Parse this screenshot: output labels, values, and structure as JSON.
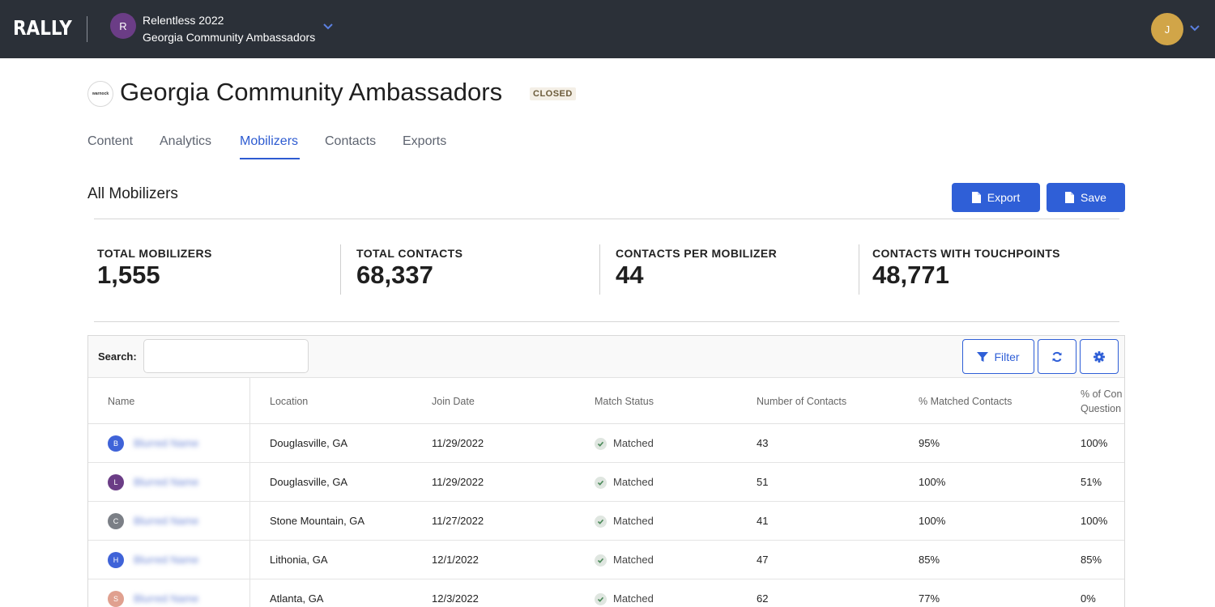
{
  "app": {
    "logo": "RALLY",
    "org_initial": "R",
    "org_campaign": "Relentless 2022",
    "org_name": "Georgia Community Ambassadors",
    "user_initial": "J"
  },
  "header": {
    "brand_logo_text": "warnock",
    "title": "Georgia Community Ambassadors",
    "status": "CLOSED"
  },
  "tabs": [
    {
      "label": "Content"
    },
    {
      "label": "Analytics"
    },
    {
      "label": "Mobilizers",
      "active": true
    },
    {
      "label": "Contacts"
    },
    {
      "label": "Exports"
    }
  ],
  "section": {
    "title": "All Mobilizers",
    "export_label": "Export",
    "save_label": "Save"
  },
  "stats": [
    {
      "label": "TOTAL MOBILIZERS",
      "value": "1,555"
    },
    {
      "label": "TOTAL CONTACTS",
      "value": "68,337"
    },
    {
      "label": "CONTACTS PER MOBILIZER",
      "value": "44"
    },
    {
      "label": "CONTACTS WITH TOUCHPOINTS",
      "value": "48,771"
    }
  ],
  "table": {
    "search_label": "Search:",
    "search_value": "",
    "filter_label": "Filter",
    "columns": [
      "Name",
      "Location",
      "Join Date",
      "Match Status",
      "Number of Contacts",
      "% Matched Contacts",
      "% of Con",
      "Question"
    ],
    "rows": [
      {
        "initial": "B",
        "avatar_color": "#3f63d8",
        "name": "Blurred Name",
        "location": "Douglasville, GA",
        "join_date": "11/29/2022",
        "match_status": "Matched",
        "contacts": "43",
        "pct_matched": "95%",
        "pct_question": "100%"
      },
      {
        "initial": "L",
        "avatar_color": "#6b3d86",
        "name": "Blurred Name",
        "location": "Douglasville, GA",
        "join_date": "11/29/2022",
        "match_status": "Matched",
        "contacts": "51",
        "pct_matched": "100%",
        "pct_question": "51%"
      },
      {
        "initial": "C",
        "avatar_color": "#7b7f86",
        "name": "Blurred Name",
        "location": "Stone Mountain, GA",
        "join_date": "11/27/2022",
        "match_status": "Matched",
        "contacts": "41",
        "pct_matched": "100%",
        "pct_question": "100%"
      },
      {
        "initial": "H",
        "avatar_color": "#3f63d8",
        "name": "Blurred Name",
        "location": "Lithonia, GA",
        "join_date": "12/1/2022",
        "match_status": "Matched",
        "contacts": "47",
        "pct_matched": "85%",
        "pct_question": "85%"
      },
      {
        "initial": "S",
        "avatar_color": "#e0a08f",
        "name": "Blurred Name",
        "location": "Atlanta, GA",
        "join_date": "12/3/2022",
        "match_status": "Matched",
        "contacts": "62",
        "pct_matched": "77%",
        "pct_question": "0%"
      }
    ]
  },
  "colors": {
    "topbar": "#2b3038",
    "accent": "#2f5fd7",
    "user_avatar": "#d1a548"
  }
}
